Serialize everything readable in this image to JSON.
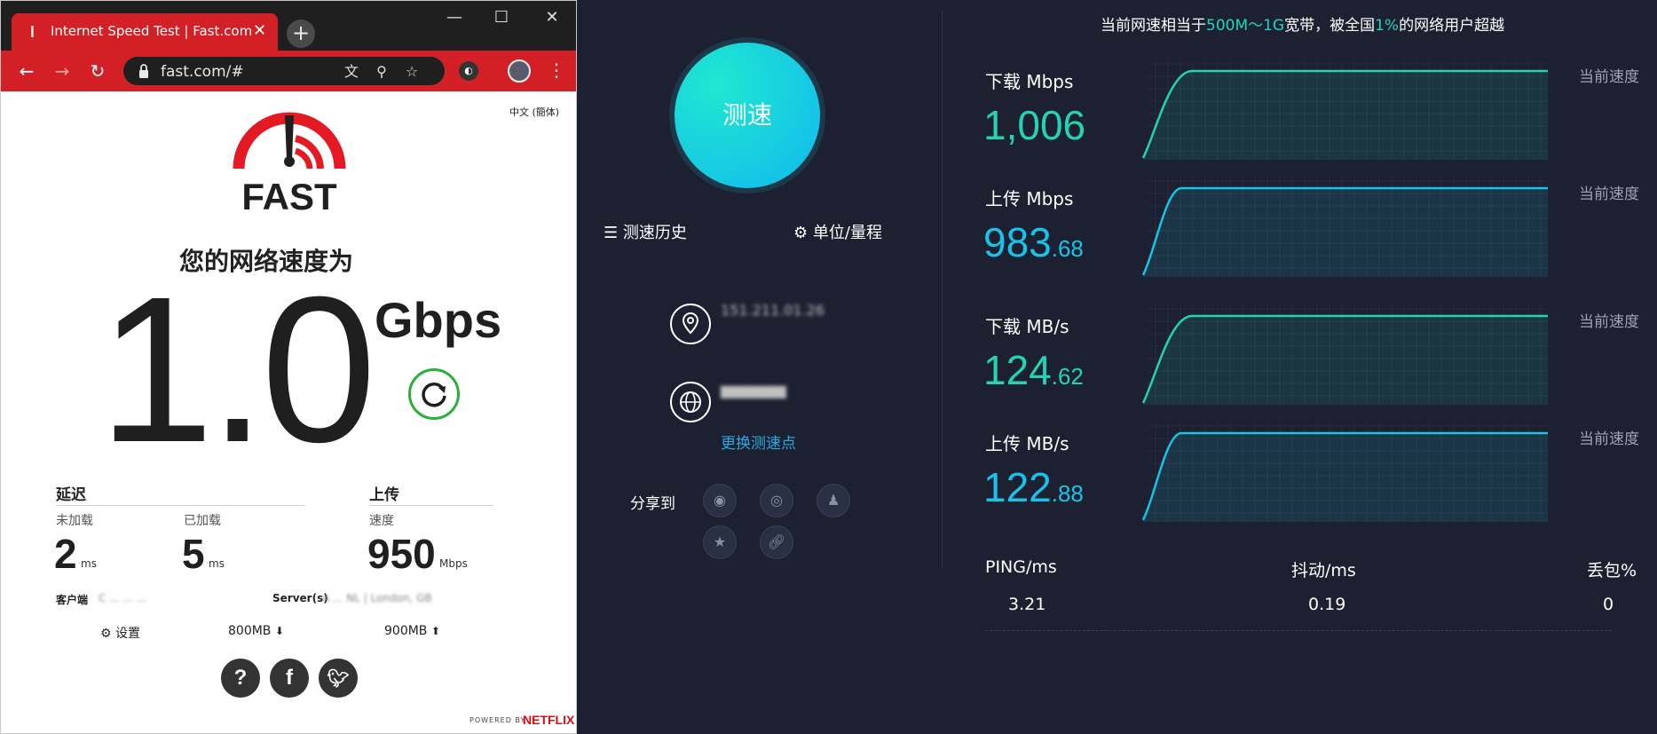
{
  "browser": {
    "tab_title": "Internet Speed Test | Fast.com",
    "tab_close": "✕",
    "new_tab": "+",
    "url": "fast.com/#",
    "window_controls": {
      "minimize": "—",
      "maximize": "☐",
      "close": "✕"
    },
    "nav": {
      "back": "←",
      "forward": "→",
      "reload": "↻"
    }
  },
  "fast": {
    "language": "中文 (簡体)",
    "logo_text": "FAST",
    "speed_label": "您的网络速度为",
    "speed_value": "1.0",
    "speed_unit": "Gbps",
    "latency": {
      "heading": "延迟",
      "unloaded_label": "未加载",
      "unloaded_value": "2",
      "loaded_label": "已加载",
      "loaded_value": "5",
      "unit": "ms"
    },
    "upload": {
      "heading": "上传",
      "speed_label": "速度",
      "value": "950",
      "unit": "Mbps"
    },
    "client_label": "客户端",
    "client_value": "C  ...  ...  ...",
    "server_label": "Server(s)",
    "server_value": "A  ...  NL | London, GB",
    "settings_label": "设置",
    "download_size": "800MB",
    "upload_size": "900MB",
    "powered_by": "POWERED BY",
    "netflix": "NETFLIX"
  },
  "dash": {
    "test_button": "测速",
    "history_label": "测速历史",
    "units_label": "单位/量程",
    "ip_text": "151.211.01.26",
    "isp_text": "▆▆▆▆▆▆",
    "change_node": "更换测速点",
    "share_label": "分享到",
    "headline": {
      "prefix": "当前网速相当于",
      "range": "500M～1G",
      "mid": "宽带，被全国",
      "percent": "1%",
      "suffix": "的网络用户超越"
    },
    "current_speed_label": "当前速度",
    "panels": [
      {
        "label": "下载 Mbps",
        "int": "1,006",
        "dec": "",
        "color": "#22d3b4"
      },
      {
        "label": "上传 Mbps",
        "int": "983",
        "dec": ".68",
        "color": "#17c3e8"
      },
      {
        "label": "下载 MB/s",
        "int": "124",
        "dec": ".62",
        "color": "#22d3b4"
      },
      {
        "label": "上传 MB/s",
        "int": "122",
        "dec": ".88",
        "color": "#17c3e8"
      }
    ],
    "stats": {
      "ping_label": "PING/ms",
      "ping_value": "3.21",
      "jitter_label": "抖动/ms",
      "jitter_value": "0.19",
      "loss_label": "丢包%",
      "loss_value": "0"
    }
  }
}
